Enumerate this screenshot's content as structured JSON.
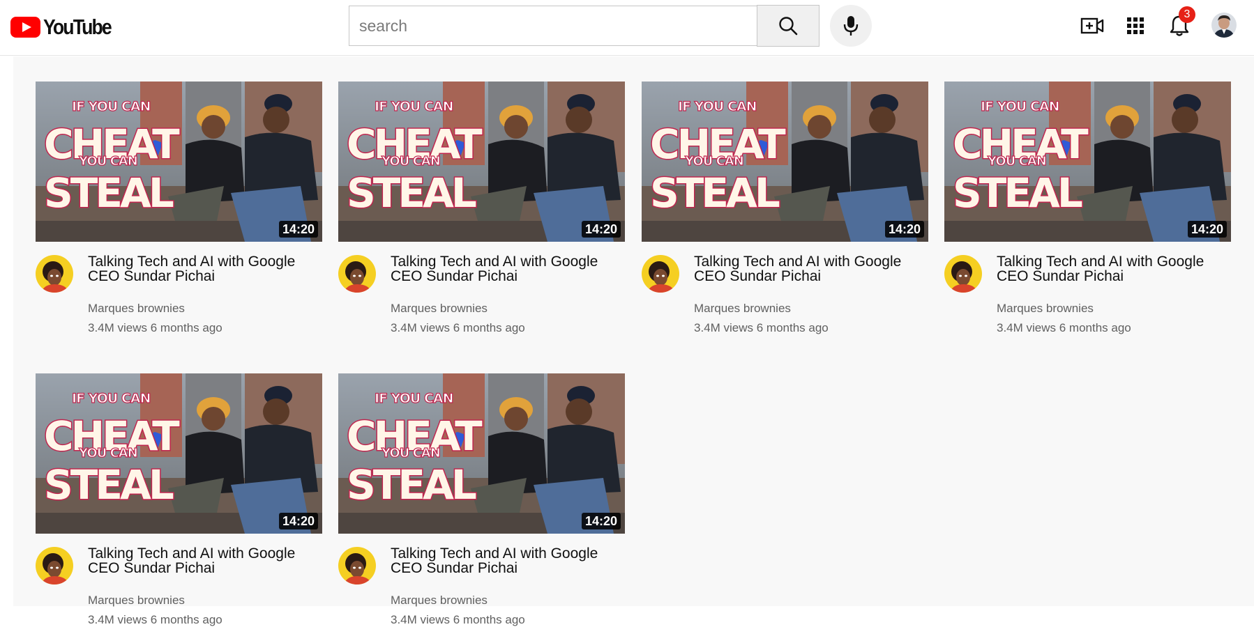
{
  "brand": {
    "name": "YouTube",
    "logo_color": "#ff0000"
  },
  "search": {
    "placeholder": "search",
    "value": ""
  },
  "header": {
    "icons": [
      "youtube-logo-icon",
      "search-icon",
      "microphone-icon",
      "create-video-icon",
      "apps-grid-icon",
      "bell-icon"
    ],
    "notification_count": "3"
  },
  "videos": [
    {
      "title": "Talking Tech and AI with Google CEO Sundar Pichai",
      "channel": "Marques brownies",
      "meta": "3.4M views 6 months ago",
      "duration": "14:20",
      "thumb_text": [
        "IF YOU CAN",
        "CHEAT",
        "YOU CAN",
        "STEAL"
      ]
    },
    {
      "title": "Talking Tech and AI with Google CEO Sundar Pichai",
      "channel": "Marques brownies",
      "meta": "3.4M views 6 months ago",
      "duration": "14:20",
      "thumb_text": [
        "IF YOU CAN",
        "CHEAT",
        "YOU CAN",
        "STEAL"
      ]
    },
    {
      "title": "Talking Tech and AI with Google CEO Sundar Pichai",
      "channel": "Marques brownies",
      "meta": "3.4M views 6 months ago",
      "duration": "14:20",
      "thumb_text": [
        "IF YOU CAN",
        "CHEAT",
        "YOU CAN",
        "STEAL"
      ]
    },
    {
      "title": "Talking Tech and AI with Google CEO Sundar Pichai",
      "channel": "Marques brownies",
      "meta": "3.4M views 6 months ago",
      "duration": "14:20",
      "thumb_text": [
        "IF YOU CAN",
        "CHEAT",
        "YOU CAN",
        "STEAL"
      ]
    },
    {
      "title": "Talking Tech and AI with Google CEO Sundar Pichai",
      "channel": "Marques brownies",
      "meta": "3.4M views 6 months ago",
      "duration": "14:20",
      "thumb_text": [
        "IF YOU CAN",
        "CHEAT",
        "YOU CAN",
        "STEAL"
      ]
    },
    {
      "title": "Talking Tech and AI with Google CEO Sundar Pichai",
      "channel": "Marques brownies",
      "meta": "3.4M views 6 months ago",
      "duration": "14:20",
      "thumb_text": [
        "IF YOU CAN",
        "CHEAT",
        "YOU CAN",
        "STEAL"
      ]
    }
  ]
}
